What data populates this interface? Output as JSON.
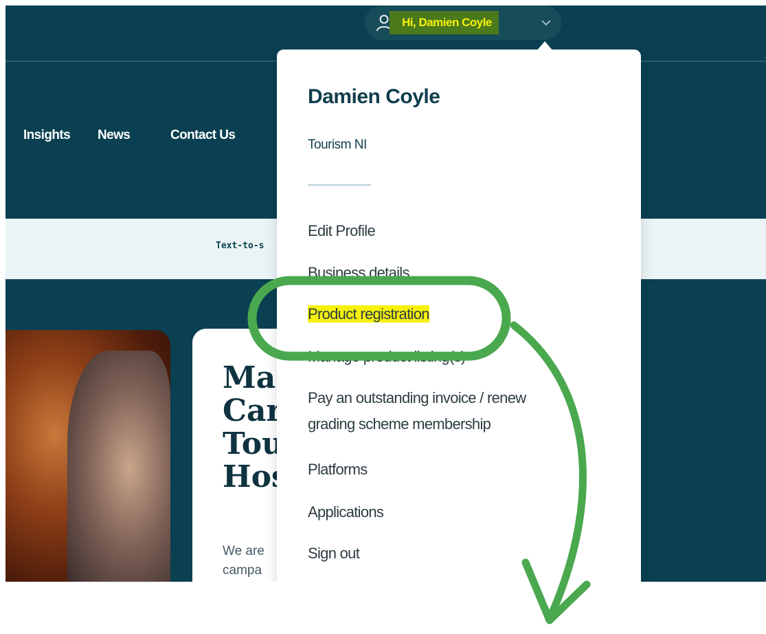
{
  "header": {
    "greeting": "Hi, Damien Coyle",
    "user_icon": "person-icon",
    "chevron_icon": "chevron-down-icon"
  },
  "nav": {
    "items": [
      "Insights",
      "News",
      "Contact Us"
    ]
  },
  "accessibility_bar": {
    "label": "Text-to-s"
  },
  "hero_card": {
    "title": "Ma\nCar\nTou\nHos",
    "body": "We are\ncampa"
  },
  "user_menu": {
    "name": "Damien Coyle",
    "organisation": "Tourism NI",
    "items": [
      "Edit Profile",
      "Business details",
      "Product registration",
      "Manage product listing(s)",
      "Pay an outstanding invoice / renew\ngrading scheme membership",
      "Platforms",
      "Applications",
      "Sign out"
    ]
  },
  "colors": {
    "page_bg": "#0a4051",
    "highlight": "#f6f10c",
    "annotation": "#4aa84e"
  }
}
